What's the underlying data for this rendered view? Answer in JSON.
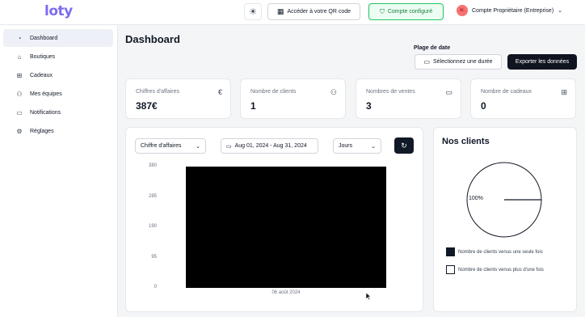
{
  "header": {
    "logo": "loty",
    "theme_icon": "sun-icon",
    "qr_label": "Accéder à votre QR code",
    "configured_label": "Compte configuré",
    "account_initials": "AL",
    "account_name": "Compte Propriétaire (Entreprise)"
  },
  "sidebar": {
    "items": [
      {
        "label": "Dashboard",
        "icon": "dashboard-icon",
        "active": true
      },
      {
        "label": "Boutiques",
        "icon": "store-icon"
      },
      {
        "label": "Cadeaux",
        "icon": "gift-icon"
      },
      {
        "label": "Mes équipes",
        "icon": "team-icon"
      },
      {
        "label": "Notifications",
        "icon": "notification-icon"
      },
      {
        "label": "Réglages",
        "icon": "gear-icon"
      }
    ]
  },
  "main": {
    "title": "Dashboard",
    "date_range_label": "Plage de date",
    "date_range_placeholder": "Sélectionnez une durée",
    "export_label": "Exporter les données",
    "stats": [
      {
        "label": "Chiffres d'affaires",
        "value": "387€",
        "icon": "euro-icon"
      },
      {
        "label": "Nombre de clients",
        "value": "1",
        "icon": "users-icon"
      },
      {
        "label": "Nombres de ventes",
        "value": "3",
        "icon": "card-icon"
      },
      {
        "label": "Nombre de cadeaux",
        "value": "0",
        "icon": "gift-icon"
      }
    ]
  },
  "chart_controls": {
    "metric": "Chiffre d'affaires",
    "date_range": "Aug 01, 2024 - Aug 31, 2024",
    "granularity": "Jours"
  },
  "chart_data": [
    {
      "type": "bar",
      "categories": [
        "06 août 2024"
      ],
      "values": [
        387
      ],
      "yticks": [
        "0",
        "95",
        "190",
        "285",
        "380"
      ],
      "ylim": [
        0,
        380
      ],
      "color": "#000000"
    },
    {
      "type": "pie",
      "title": "Nos clients",
      "categories": [
        "Nombre de clients venus une seule fois",
        "Nombre de clients venus plus d'une fois"
      ],
      "values": [
        100,
        0
      ],
      "slice_label": "100%",
      "colors": [
        "#ffffff",
        "#ffffff"
      ]
    }
  ],
  "clients_card": {
    "title": "Nos clients",
    "pie_label": "100%",
    "legend": [
      {
        "label": "Nombre de clients venus une seule fois",
        "color": "#111827"
      },
      {
        "label": "Nombre de clients venus plus d'une fois",
        "color": "#ffffff"
      }
    ]
  }
}
